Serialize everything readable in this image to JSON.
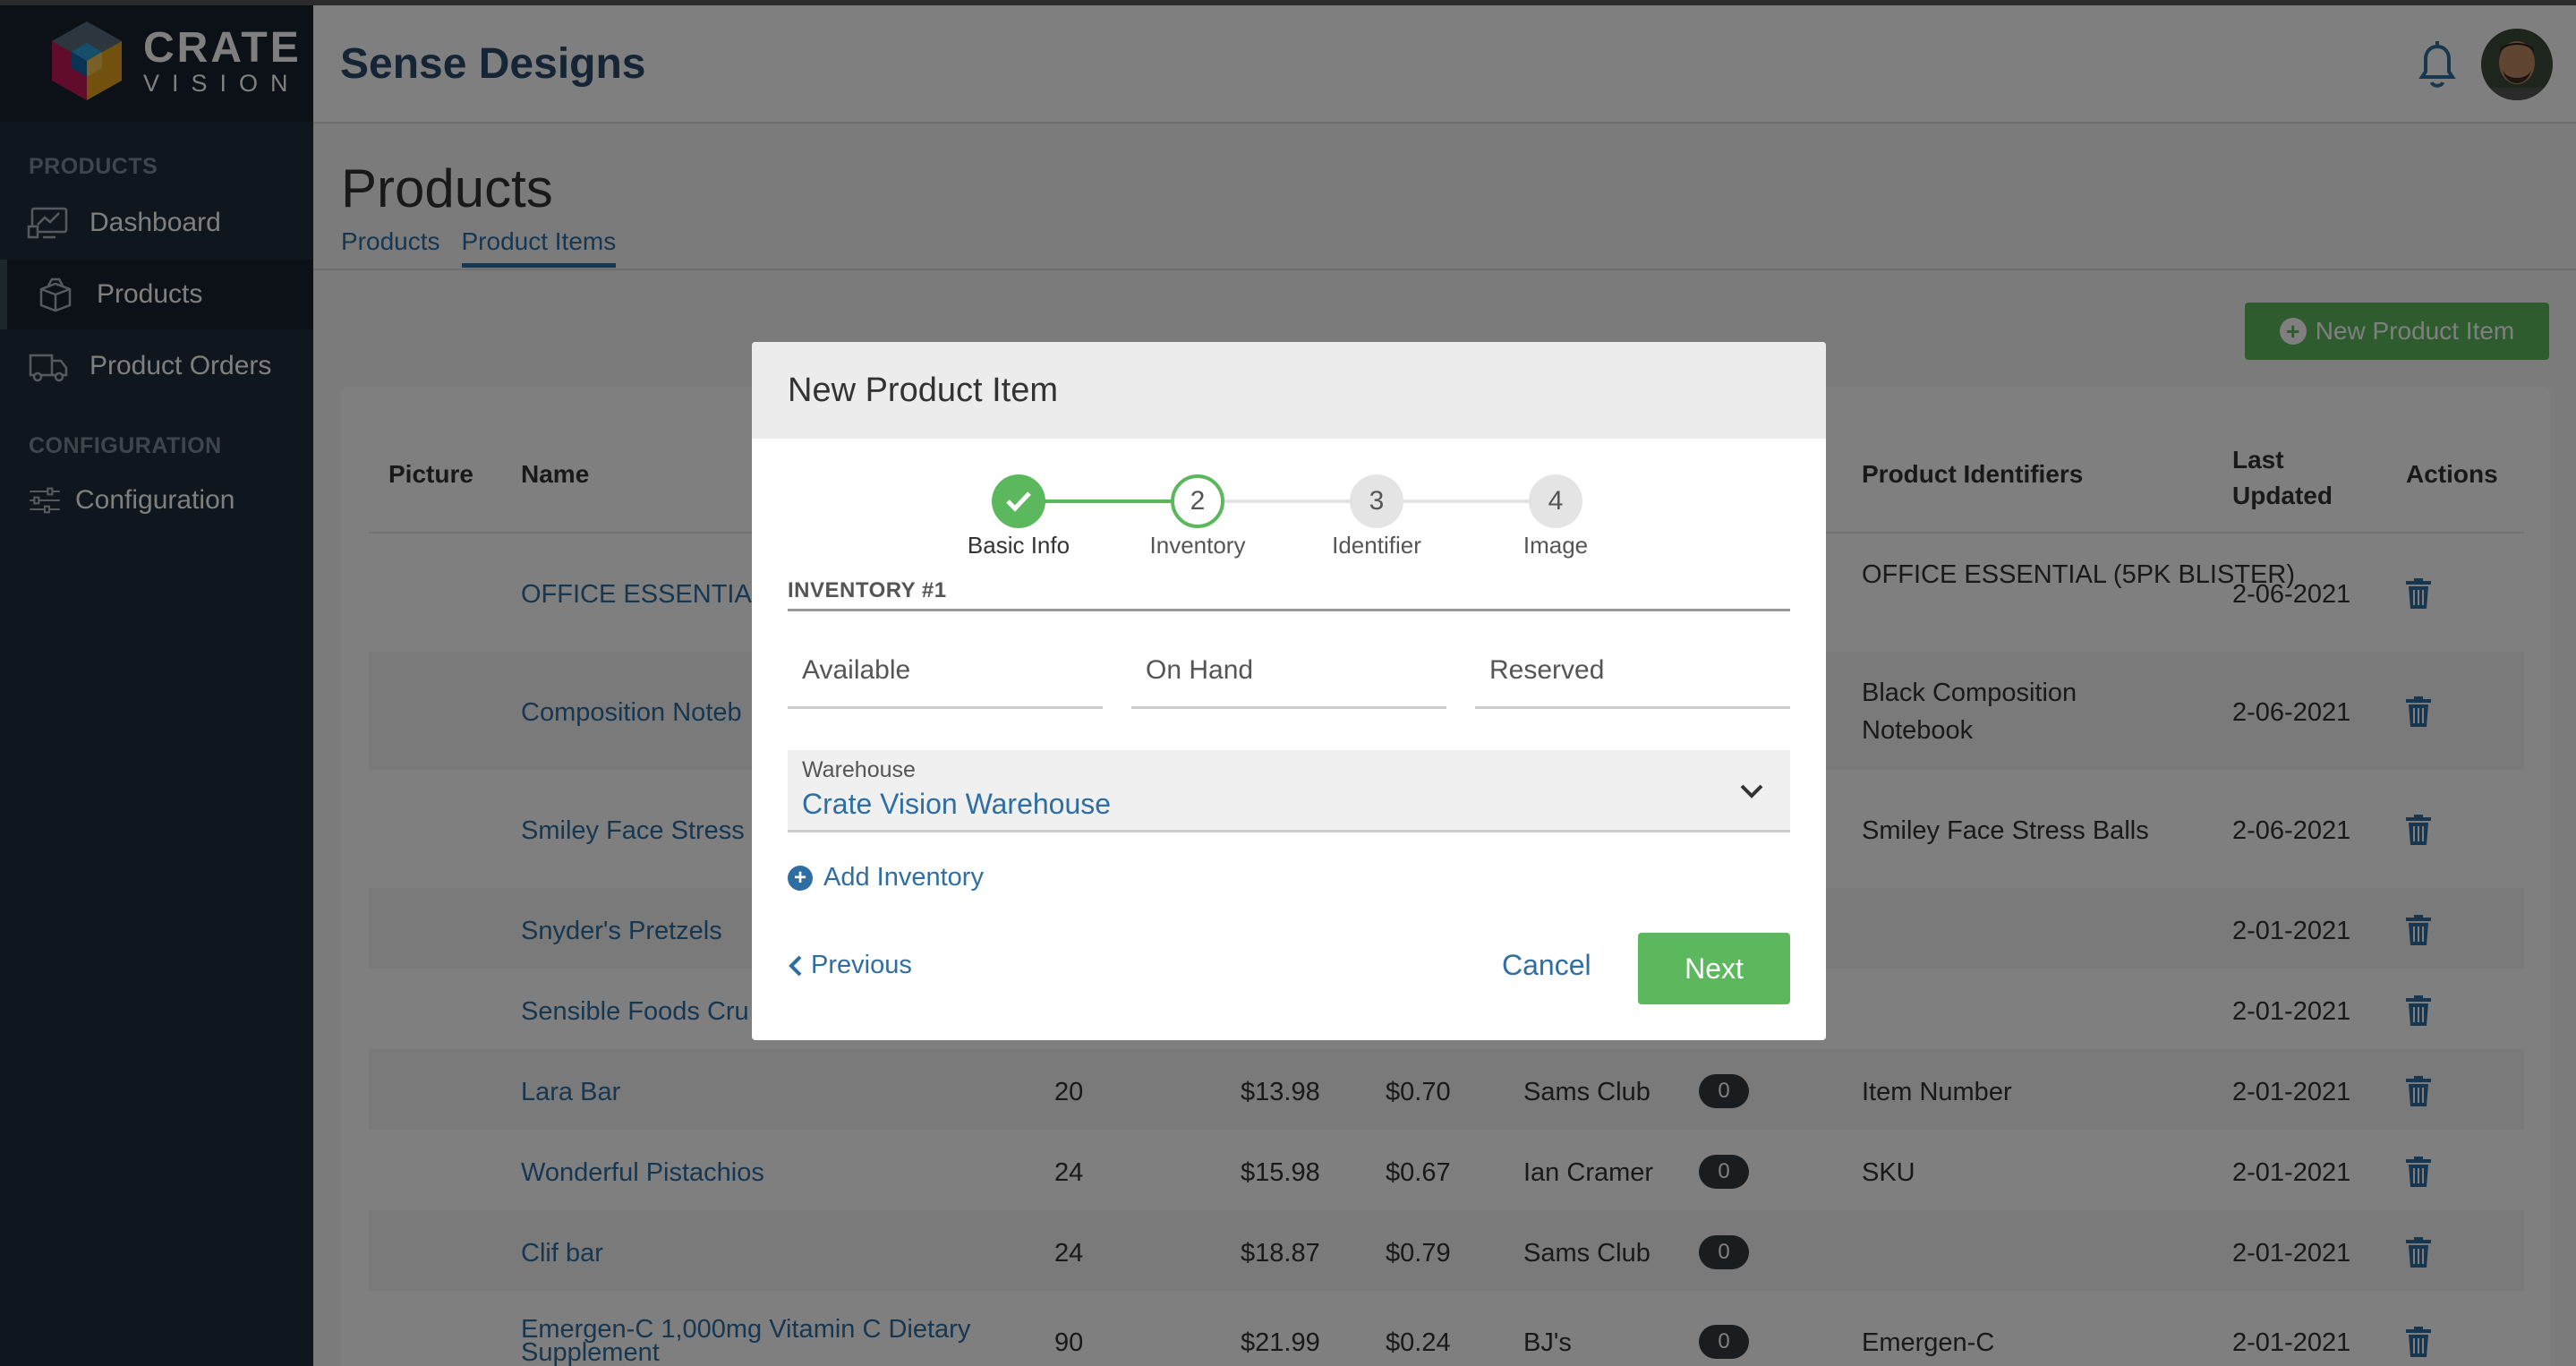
{
  "brand": {
    "line1": "CRATE",
    "line2": "VISION"
  },
  "sidebar": {
    "section_products": "PRODUCTS",
    "section_config": "CONFIGURATION",
    "items": [
      {
        "label": "Dashboard",
        "icon": "dashboard-icon"
      },
      {
        "label": "Products",
        "icon": "box-icon",
        "active": true
      },
      {
        "label": "Product Orders",
        "icon": "truck-icon"
      },
      {
        "label": "Configuration",
        "icon": "sliders-icon"
      }
    ]
  },
  "header": {
    "company": "Sense Designs"
  },
  "page": {
    "title": "Products",
    "tabs": [
      "Products",
      "Product Items"
    ],
    "new_button": "New Product Item"
  },
  "table": {
    "headers": {
      "picture": "Picture",
      "name": "Name",
      "identifiers": "Product Identifiers",
      "updated": "Last Updated",
      "actions": "Actions"
    },
    "rows": [
      {
        "name": "OFFICE ESSENTIAL",
        "qty": "",
        "price": "",
        "unit": "",
        "vendor": "",
        "badge": "",
        "identifier": "OFFICE ESSENTIAL (5PK BLISTER)",
        "identifier2": "",
        "updated": "2-06-2021"
      },
      {
        "name": "Composition Noteb",
        "qty": "",
        "price": "",
        "unit": "",
        "vendor": "",
        "badge": "",
        "identifier": "Black Composition",
        "identifier2": "Notebook",
        "updated": "2-06-2021"
      },
      {
        "name": "Smiley Face Stress",
        "qty": "",
        "price": "",
        "unit": "",
        "vendor": "",
        "badge": "",
        "identifier": "Smiley Face Stress Balls",
        "identifier2": "",
        "updated": "2-06-2021"
      },
      {
        "name": "Snyder's Pretzels",
        "qty": "",
        "price": "",
        "unit": "",
        "vendor": "",
        "badge": "",
        "identifier": "",
        "identifier2": "",
        "updated": "2-01-2021"
      },
      {
        "name": "Sensible Foods Cru",
        "qty": "",
        "price": "",
        "unit": "",
        "vendor": "",
        "badge": "",
        "identifier": "",
        "identifier2": "",
        "updated": "2-01-2021"
      },
      {
        "name": "Lara Bar",
        "qty": "20",
        "price": "$13.98",
        "unit": "$0.70",
        "vendor": "Sams Club",
        "badge": "0",
        "identifier": "Item Number",
        "identifier2": "",
        "updated": "2-01-2021"
      },
      {
        "name": "Wonderful Pistachios",
        "qty": "24",
        "price": "$15.98",
        "unit": "$0.67",
        "vendor": "Ian Cramer",
        "badge": "0",
        "identifier": "SKU",
        "identifier2": "",
        "updated": "2-01-2021"
      },
      {
        "name": "Clif bar",
        "qty": "24",
        "price": "$18.87",
        "unit": "$0.79",
        "vendor": "Sams Club",
        "badge": "0",
        "identifier": "",
        "identifier2": "",
        "updated": "2-01-2021"
      },
      {
        "name": "Emergen-C 1,000mg Vitamin C Dietary",
        "name2": "Supplement",
        "qty": "90",
        "price": "$21.99",
        "unit": "$0.24",
        "vendor": "BJ's",
        "badge": "0",
        "identifier": "Emergen-C",
        "identifier2": "",
        "updated": "2-01-2021"
      }
    ]
  },
  "modal": {
    "title": "New Product Item",
    "steps": [
      {
        "label": "Basic Info",
        "num": "1",
        "state": "done"
      },
      {
        "label": "Inventory",
        "num": "2",
        "state": "current"
      },
      {
        "label": "Identifier",
        "num": "3",
        "state": "todo"
      },
      {
        "label": "Image",
        "num": "4",
        "state": "todo"
      }
    ],
    "inventory_title": "INVENTORY #1",
    "fields": {
      "available": "Available",
      "on_hand": "On Hand",
      "reserved": "Reserved"
    },
    "warehouse_label": "Warehouse",
    "warehouse_value": "Crate Vision Warehouse",
    "add_inventory": "Add Inventory",
    "previous": "Previous",
    "cancel": "Cancel",
    "next": "Next"
  },
  "colors": {
    "green": "#5cb85c",
    "link": "#2f6ea3",
    "sidebar": "#1f2d3b"
  }
}
